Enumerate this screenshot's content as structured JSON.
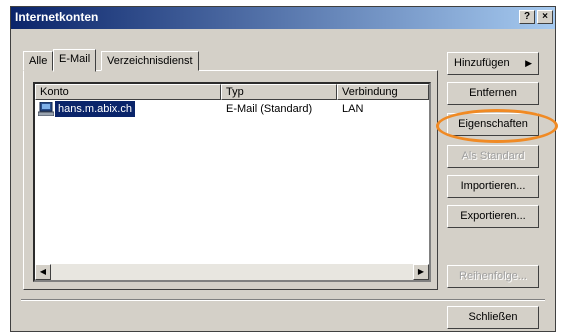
{
  "window": {
    "title": "Internetkonten",
    "help_label": "?",
    "close_label": "×"
  },
  "tabs": [
    {
      "label": "Alle"
    },
    {
      "label": "E-Mail"
    },
    {
      "label": "Verzeichnisdienst"
    }
  ],
  "list": {
    "columns": [
      "Konto",
      "Typ",
      "Verbindung"
    ],
    "rows": [
      {
        "konto": "hans.m.abix.ch",
        "typ": "E-Mail (Standard)",
        "verbindung": "LAN"
      }
    ]
  },
  "buttons": {
    "add": "Hinzufügen",
    "remove": "Entfernen",
    "properties": "Eigenschaften",
    "set_default": "Als Standard",
    "import": "Importieren...",
    "export": "Exportieren...",
    "order": "Reihenfolge...",
    "close": "Schließen"
  },
  "colors": {
    "title_bar": "#0a246a",
    "selection": "#0a246a",
    "annotation": "#f08a24"
  }
}
